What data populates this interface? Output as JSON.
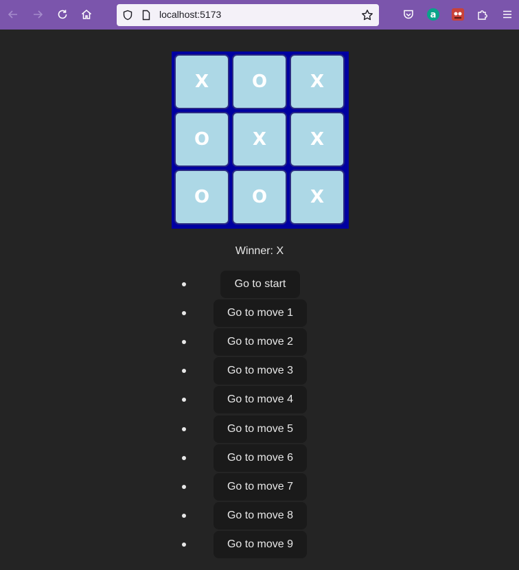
{
  "browser": {
    "url": "localhost:5173",
    "toolbar_color": "#7b55ac",
    "icons": [
      "back-arrow-icon",
      "forward-arrow-icon",
      "reload-icon",
      "home-icon",
      "shield-icon",
      "page-info-icon",
      "bookmark-star-icon",
      "pocket-icon",
      "extension-a-icon",
      "extension-avatar-icon",
      "extensions-puzzle-icon",
      "menu-hamburger-icon"
    ]
  },
  "board": {
    "squares": [
      "X",
      "O",
      "X",
      "O",
      "X",
      "X",
      "O",
      "O",
      "X"
    ],
    "board_color": "#0000a0",
    "square_color": "#add8e6"
  },
  "status": "Winner: X",
  "moves": [
    "Go to start",
    "Go to move 1",
    "Go to move 2",
    "Go to move 3",
    "Go to move 4",
    "Go to move 5",
    "Go to move 6",
    "Go to move 7",
    "Go to move 8",
    "Go to move 9"
  ]
}
